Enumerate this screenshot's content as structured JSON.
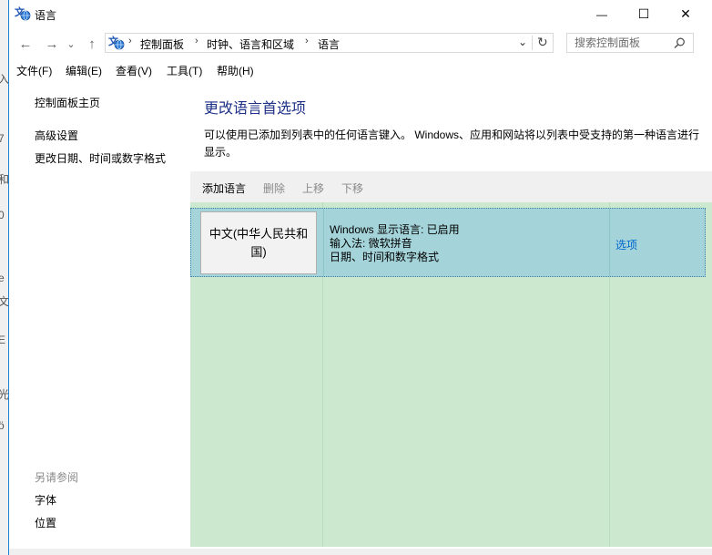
{
  "window": {
    "title": "语言",
    "minimize_glyph": "—",
    "maximize_glyph": "☐",
    "close_glyph": "✕"
  },
  "nav": {
    "back": "←",
    "forward": "→",
    "dropdown": "⌄",
    "up": "↑",
    "breadcrumb": [
      "控制面板",
      "时钟、语言和区域",
      "语言"
    ],
    "crumb_sep": "›",
    "address_dropdown": "⌄",
    "refresh": "↻",
    "search_placeholder": "搜索控制面板"
  },
  "menu": [
    "文件(F)",
    "编辑(E)",
    "查看(V)",
    "工具(T)",
    "帮助(H)"
  ],
  "left_pane": {
    "home": "控制面板主页",
    "advanced": "高级设置",
    "change_datetime": "更改日期、时间或数字格式",
    "see_also": "另请参阅",
    "fonts": "字体",
    "location": "位置"
  },
  "main": {
    "title": "更改语言首选项",
    "description": "可以使用已添加到列表中的任何语言键入。 Windows、应用和网站将以列表中受支持的第一种语言进行显示。",
    "toolbar": {
      "add": "添加语言",
      "remove": "删除",
      "move_up": "上移",
      "move_down": "下移"
    },
    "languages": [
      {
        "name": "中文(中华人民共和国)",
        "display_language": "Windows 显示语言: 已启用",
        "input_method": "输入法: 微软拼音",
        "format": "日期、时间和数字格式",
        "options": "选项"
      }
    ]
  },
  "background_glyphs": [
    "入",
    "7",
    "和",
    "0",
    "e",
    "文",
    "E",
    "光",
    "ö"
  ],
  "colors": {
    "accent_border": "#1883d7",
    "title_blue": "#1e3287",
    "link_blue": "#0066cc",
    "list_green": "#cce8cf",
    "selected_row": "#a4d4da",
    "toolbar_gray": "#f0f0f0",
    "disabled_text": "#8a8a8a"
  }
}
